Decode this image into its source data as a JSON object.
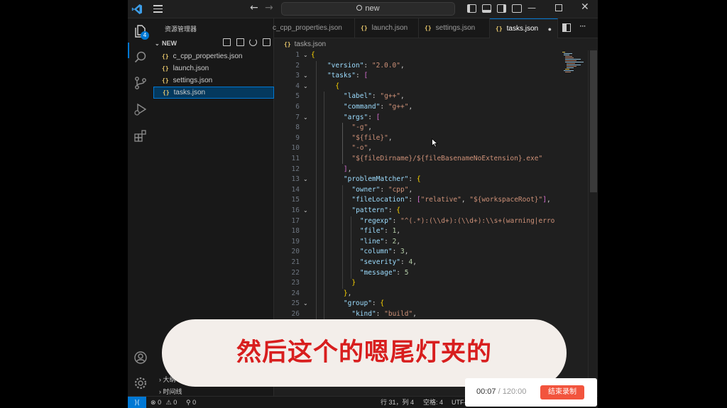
{
  "titlebar": {
    "search_text": "new",
    "icons": [
      "vscode-logo-icon",
      "menu-icon",
      "arrow-left-icon",
      "arrow-right-icon",
      "search-icon",
      "toggle-primary-sidebar-icon",
      "toggle-panel-icon",
      "toggle-secondary-sidebar-icon",
      "customize-layout-icon",
      "minimize-icon",
      "maximize-icon",
      "close-icon"
    ]
  },
  "activity_bar": {
    "explorer_badge": "4",
    "icons": [
      "explorer-icon",
      "search-icon",
      "source-control-icon",
      "run-debug-icon",
      "extensions-icon",
      "account-icon",
      "manage-gear-icon"
    ]
  },
  "sidebar": {
    "title": "资源管理器",
    "folder": "NEW",
    "files": [
      "c_cpp_properties.json",
      "launch.json",
      "settings.json",
      "tasks.json"
    ],
    "active_file_index": 3,
    "outline": "大纲",
    "timeline": "时间线"
  },
  "tabs": [
    {
      "label": "c_cpp_properties.json",
      "active": false
    },
    {
      "label": "launch.json",
      "active": false
    },
    {
      "label": "settings.json",
      "active": false
    },
    {
      "label": "tasks.json",
      "active": true
    }
  ],
  "breadcrumb": "tasks.json",
  "editor": {
    "line_numbers": [
      "1",
      "2",
      "3",
      "4",
      "5",
      "6",
      "7",
      "8",
      "9",
      "10",
      "11",
      "12",
      "13",
      "14",
      "15",
      "16",
      "17",
      "18",
      "19",
      "20",
      "21",
      "22",
      "23",
      "24",
      "25",
      "26"
    ],
    "lines": [
      "{",
      "    \"version\": \"2.0.0\",",
      "    \"tasks\": [",
      "      {",
      "        \"label\": \"g++\",",
      "        \"command\": \"g++\",",
      "        \"args\": [",
      "          \"-g\",",
      "          \"${file}\",",
      "          \"-o\",",
      "          \"${fileDirname}/${fileBasenameNoExtension}.exe\"",
      "        ],",
      "        \"problemMatcher\": {",
      "          \"owner\": \"cpp\",",
      "          \"fileLocation\": [\"relative\", \"${workspaceRoot}\"],",
      "          \"pattern\": {",
      "            \"regexp\": \"^(.*):(\\\\d+):(\\\\d+):\\\\s+(warning|erro",
      "            \"file\": 1,",
      "            \"line\": 2,",
      "            \"column\": 3,",
      "            \"severity\": 4,",
      "            \"message\": 5",
      "          }",
      "        },",
      "        \"group\": {",
      "          \"kind\": \"build\","
    ]
  },
  "statusbar": {
    "remote_icon": "remote-icon",
    "errors": "0",
    "warnings": "0",
    "ports": "0",
    "position": "行 31，列 4",
    "indent": "空格: 4",
    "encoding": "UTF-"
  },
  "subtitle": "然后这个的嗯尾灯夹的",
  "recorder": {
    "elapsed": "00:07",
    "separator": " / ",
    "total": "120:00",
    "stop_label": "结束录制"
  },
  "colors": {
    "accent": "#0078d4",
    "background": "#1f1f1f",
    "subtitle_text": "#d81e1e",
    "stop_button": "#f2543d"
  }
}
